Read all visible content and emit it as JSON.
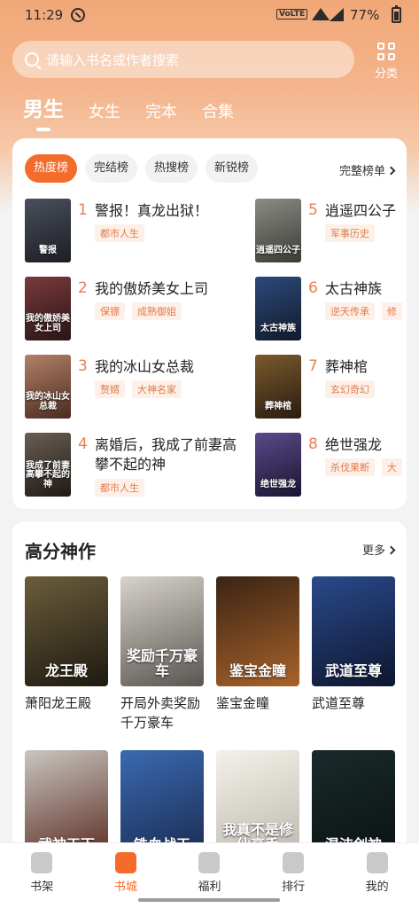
{
  "status_bar": {
    "time": "11:29",
    "network": "VoLTE",
    "battery": "77%"
  },
  "search": {
    "placeholder": "请输入书名或作者搜索",
    "category_label": "分类"
  },
  "gender_tabs": [
    "男生",
    "女生",
    "完本",
    "合集"
  ],
  "ranking": {
    "tabs": [
      "热度榜",
      "完结榜",
      "热搜榜",
      "新锐榜"
    ],
    "more_label": "完整榜单",
    "items": [
      {
        "rank": "1",
        "title": "警报！真龙出狱！",
        "tags": [
          "都市人生"
        ],
        "cover_text": "警报",
        "cover_colors": [
          "#4a4f5c",
          "#1c1e24"
        ]
      },
      {
        "rank": "2",
        "title": "我的傲娇美女上司",
        "tags": [
          "保镖",
          "成熟御姐"
        ],
        "cover_text": "我的傲娇美女上司",
        "cover_colors": [
          "#7a3a3a",
          "#2a1518"
        ]
      },
      {
        "rank": "3",
        "title": "我的冰山女总裁",
        "tags": [
          "赘婿",
          "大神名家"
        ],
        "cover_text": "我的冰山女总裁",
        "cover_colors": [
          "#b38066",
          "#4a2b22"
        ]
      },
      {
        "rank": "4",
        "title": "离婚后，我成了前妻高攀不起的神",
        "tags": [
          "都市人生"
        ],
        "cover_text": "我成了前妻高攀不起的神",
        "cover_colors": [
          "#6a5e52",
          "#1f1a16"
        ]
      },
      {
        "rank": "5",
        "title": "逍遥四公子",
        "tags": [
          "军事历史"
        ],
        "cover_text": "逍遥四公子",
        "cover_colors": [
          "#8c8c86",
          "#3b3a35"
        ]
      },
      {
        "rank": "6",
        "title": "太古神族",
        "tags": [
          "逆天传承",
          "修"
        ],
        "cover_text": "太古神族",
        "cover_colors": [
          "#2d4a7a",
          "#111a2b"
        ]
      },
      {
        "rank": "7",
        "title": "葬神棺",
        "tags": [
          "玄幻奇幻"
        ],
        "cover_text": "葬神棺",
        "cover_colors": [
          "#7a5a2e",
          "#2a1c10"
        ]
      },
      {
        "rank": "8",
        "title": "绝世强龙",
        "tags": [
          "杀伐果断",
          "大"
        ],
        "cover_text": "绝世强龙",
        "cover_colors": [
          "#5a4a8a",
          "#1a1530"
        ]
      }
    ]
  },
  "top_picks": {
    "title": "高分神作",
    "more_label": "更多",
    "books": [
      {
        "title": "萧阳龙王殿",
        "cover_text": "龙王殿",
        "cover_colors": [
          "#6b5d3c",
          "#1e1a10"
        ]
      },
      {
        "title": "开局外卖奖励千万豪车",
        "cover_text": "奖励千万豪车",
        "cover_colors": [
          "#d7d3cc",
          "#5a5550"
        ]
      },
      {
        "title": "鉴宝金瞳",
        "cover_text": "鉴宝金瞳",
        "cover_colors": [
          "#3a2414",
          "#a8622a"
        ]
      },
      {
        "title": "武道至尊",
        "cover_text": "武道至尊",
        "cover_colors": [
          "#2a4a8a",
          "#0e1630"
        ]
      },
      {
        "title": "",
        "cover_text": "武神天下",
        "cover_colors": [
          "#c9c6c0",
          "#5a2a20"
        ]
      },
      {
        "title": "",
        "cover_text": "铁血战天",
        "cover_colors": [
          "#3a6ab0",
          "#1a2a50"
        ]
      },
      {
        "title": "",
        "cover_text": "我真不是修仙高手",
        "cover_colors": [
          "#f4f1ea",
          "#bcb8ae"
        ]
      },
      {
        "title": "",
        "cover_text": "混沌剑神",
        "cover_colors": [
          "#1a2a2a",
          "#0a1212"
        ]
      }
    ]
  },
  "bottom_nav": {
    "items": [
      {
        "label": "书架",
        "icon": "bookshelf-icon"
      },
      {
        "label": "书城",
        "icon": "bookstore-icon"
      },
      {
        "label": "福利",
        "icon": "gift-icon"
      },
      {
        "label": "排行",
        "icon": "ranking-icon"
      },
      {
        "label": "我的",
        "icon": "profile-icon"
      }
    ],
    "active_index": 1
  },
  "colors": {
    "accent": "#f36c2b",
    "tag_text": "#e07b4a",
    "rank_number": "#e77f52"
  }
}
